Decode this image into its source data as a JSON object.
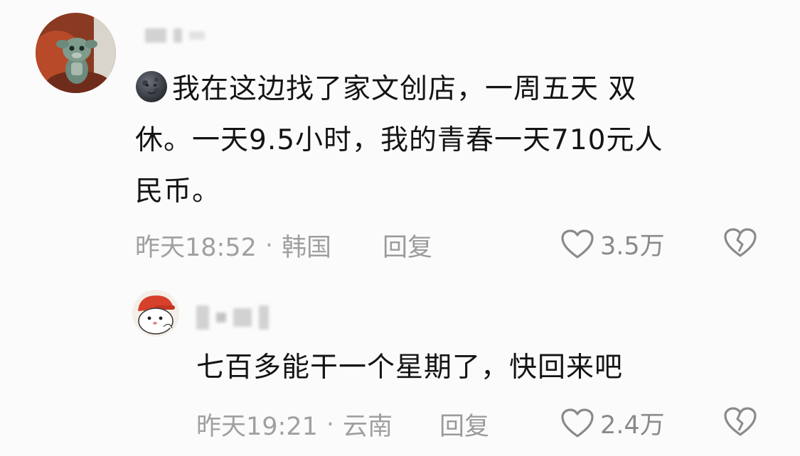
{
  "comments": [
    {
      "text_line1": "我在这边找了家文创店，一周五天 双",
      "text_line2": "休。一天9.5小时，我的青春一天710元人",
      "text_line3": "民币。",
      "time": "昨天18:52",
      "separator": "·",
      "location": "韩国",
      "reply_label": "回复",
      "like_count": "3.5万"
    },
    {
      "text": "七百多能干一个星期了，快回来吧",
      "time": "昨天19:21",
      "separator": "·",
      "location": "云南",
      "reply_label": "回复",
      "like_count": "2.4万"
    }
  ],
  "icons": {
    "emoji": "new-moon-face-emoji",
    "like": "heart-outline-icon",
    "dislike": "broken-heart-icon"
  },
  "colors": {
    "background": "#fbfbfb",
    "text": "#141414",
    "meta": "#9a9a9a"
  }
}
